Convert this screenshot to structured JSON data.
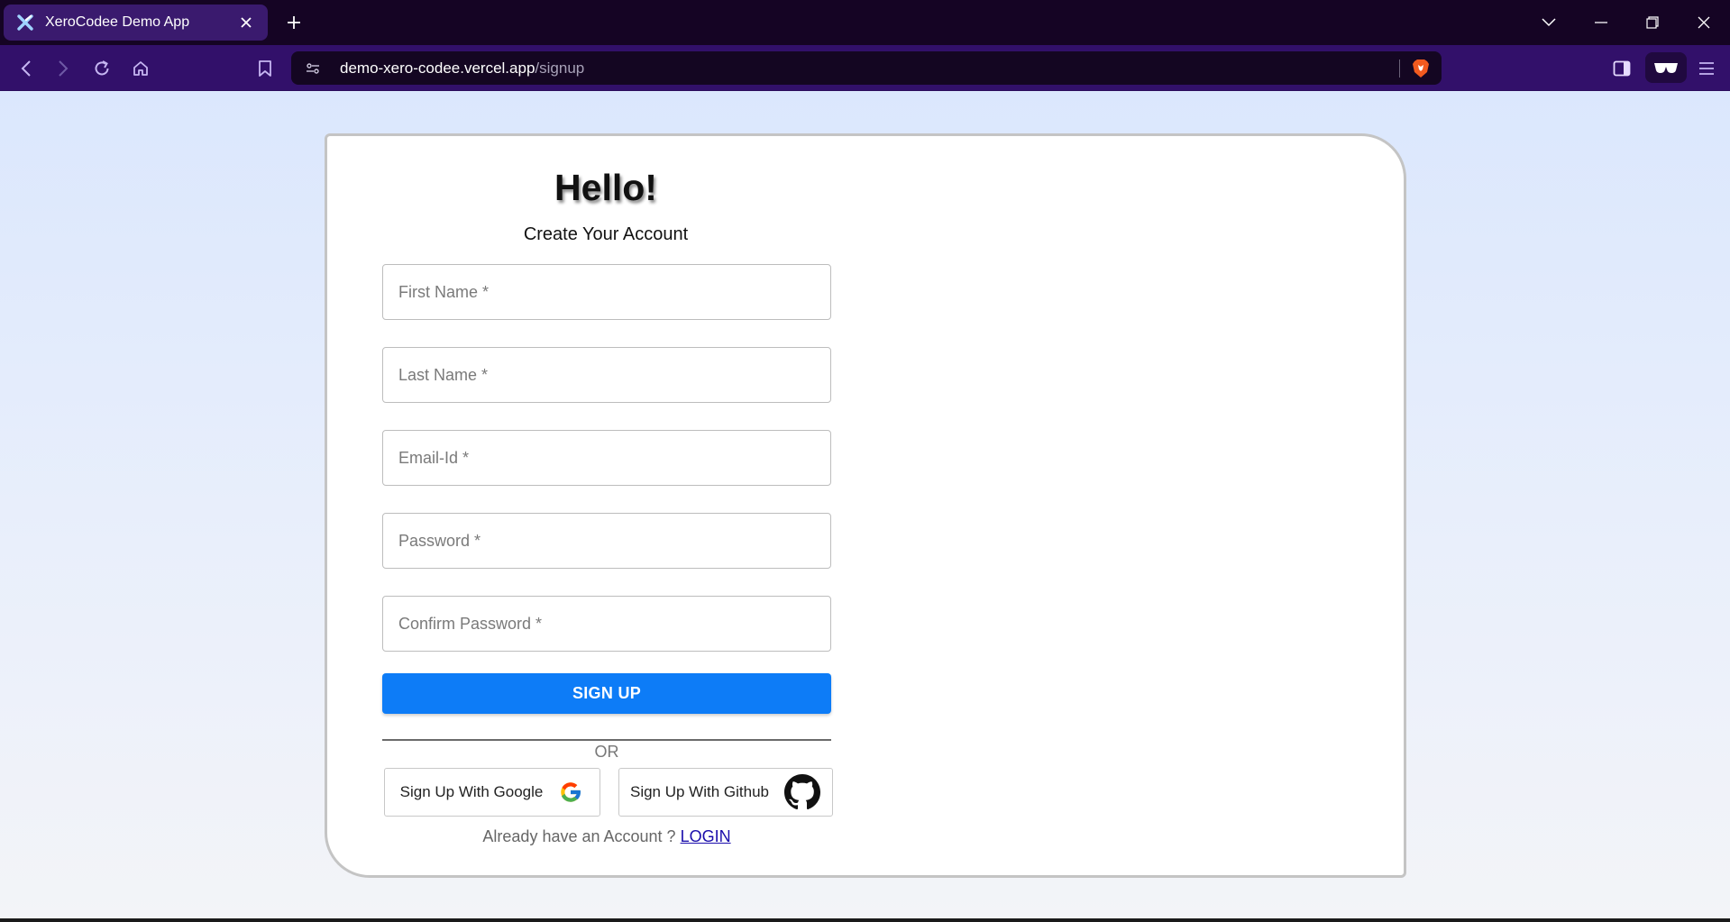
{
  "browser": {
    "tab_title": "XeroCodee Demo App",
    "url_host": "demo-xero-codee.vercel.app",
    "url_path": "/signup"
  },
  "page": {
    "heading": "Hello!",
    "subheading": "Create Your Account",
    "fields": {
      "first_name": "First Name *",
      "last_name": "Last Name *",
      "email": "Email-Id *",
      "password": "Password *",
      "confirm_password": "Confirm Password *"
    },
    "signup_label": "SIGN UP",
    "or_label": "OR",
    "google_label": "Sign Up With Google",
    "github_label": "Sign Up With Github",
    "login_prompt": "Already have an Account ?",
    "login_link": "LOGIN"
  },
  "colors": {
    "accent": "#0d7cf7",
    "link": "#1a0dab",
    "toolbar": "#32106a",
    "tabstrip": "#150424"
  }
}
